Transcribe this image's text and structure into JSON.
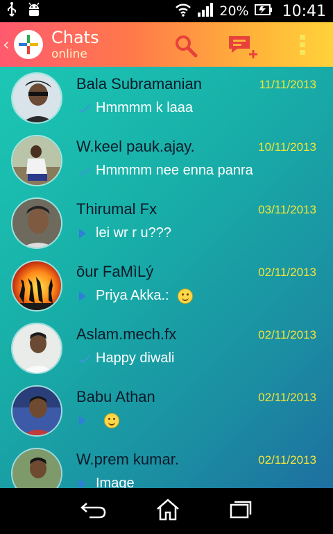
{
  "status_bar": {
    "battery_percent": "20%",
    "time": "10:41",
    "icons": [
      "usb-icon",
      "android-debug-icon",
      "wifi-icon",
      "signal-icon",
      "battery-icon"
    ]
  },
  "action_bar": {
    "title": "Chats",
    "subtitle": "online",
    "icons": [
      "app-logo-icon",
      "search-icon",
      "new-chat-icon",
      "overflow-menu-icon"
    ],
    "colors": {
      "gradient_start": "#ff5a6e",
      "gradient_end": "#ffd23a"
    }
  },
  "chats": [
    {
      "name": "Bala Subramanian",
      "date": "11/11/2013",
      "message": "Hmmmm k laaa",
      "status": "sent-check",
      "emoji": false
    },
    {
      "name": "W.keel pauk.ajay.",
      "date": "10/11/2013",
      "message": "Hmmmm nee enna panra",
      "status": "sent-check",
      "emoji": false
    },
    {
      "name": "Thirumal Fx",
      "date": "03/11/2013",
      "message": "lei wr r u???",
      "status": "received-arrow",
      "emoji": false
    },
    {
      "name": "ōur FaMìLý",
      "date": "02/11/2013",
      "message": "Priya Akka.:",
      "status": "received-arrow",
      "emoji": true
    },
    {
      "name": "Aslam.mech.fx",
      "date": "02/11/2013",
      "message": "Happy diwali",
      "status": "sent-check",
      "emoji": false
    },
    {
      "name": "Babu Athan",
      "date": "02/11/2013",
      "message": "",
      "status": "received-arrow",
      "emoji": true
    },
    {
      "name": "W.prem kumar.",
      "date": "02/11/2013",
      "message": "Image",
      "status": "received-arrow",
      "emoji": false
    }
  ],
  "colors": {
    "list_bg_start": "#1cc7b4",
    "list_bg_end": "#1e6fa0",
    "date_color": "#f3e43a",
    "name_color": "#0b1a2a"
  },
  "nav_bar": {
    "icons": [
      "back-icon",
      "home-icon",
      "recent-apps-icon"
    ]
  }
}
